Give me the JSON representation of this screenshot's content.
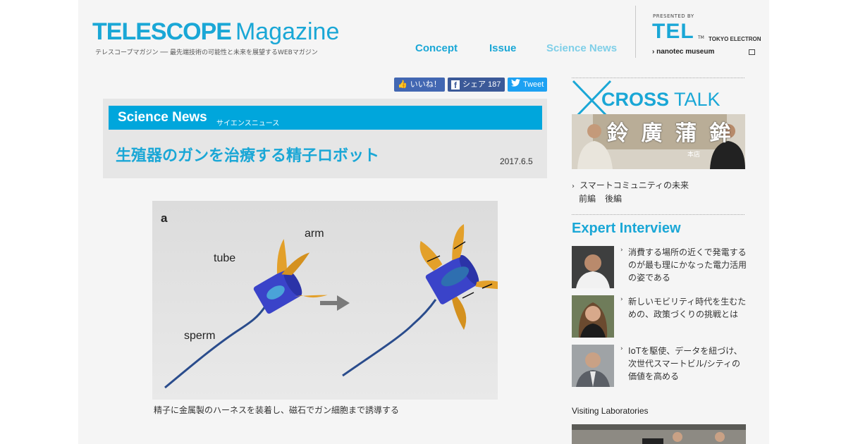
{
  "brand": {
    "logo_bold": "TELESCOPE",
    "logo_light": "Magazine",
    "tagline": "テレスコープマガジン ── 最先端技術の可能性と未来を展望するWEBマガジン"
  },
  "nav": [
    {
      "label": "Concept"
    },
    {
      "label": "Issue"
    },
    {
      "label": "Science News"
    }
  ],
  "sponsor": {
    "presented_by": "PRESENTED BY",
    "tel": "TEL",
    "tm": "TM",
    "tokyo_electron": "TOKYO ELECTRON",
    "museum": "nanotec museum"
  },
  "social": {
    "like": "いいね！",
    "share": "シェア 187",
    "tweet": "Tweet"
  },
  "article": {
    "section": "Science News",
    "section_sub": "サイエンスニュース",
    "title": "生殖器のガンを治療する精子ロボット",
    "date": "2017.6.5",
    "figure": {
      "panel": "a",
      "arm": "arm",
      "tube": "tube",
      "sperm": "sperm",
      "caption": "精子に金属製のハーネスを装着し、磁石でガン細胞まで誘導する"
    }
  },
  "sidebar": {
    "crosstalk": {
      "title_bold": "CROSS",
      "title_light": "TALK",
      "topic": "スマートコミュニティの未来",
      "link_1": "前編",
      "link_2": "後編",
      "photo_text": "鈴 廣 蒲 鉾",
      "photo_subtext": "本店"
    },
    "expert_title": "Expert Interview",
    "experts": [
      {
        "text": "消費する場所の近くで発電するのが最も理にかなった電力活用の姿である"
      },
      {
        "text": "新しいモビリティ時代を生むための、政策づくりの挑戦とは"
      },
      {
        "text": "IoTを駆使、データを紐づけ、次世代スマートビル/シティの価値を高める"
      }
    ],
    "visiting": "Visiting Laboratories"
  },
  "colors": {
    "accent": "#1aa7d6",
    "section_bar": "#00a6dc",
    "facebook": "#3b5998",
    "twitter": "#1da1f2"
  }
}
